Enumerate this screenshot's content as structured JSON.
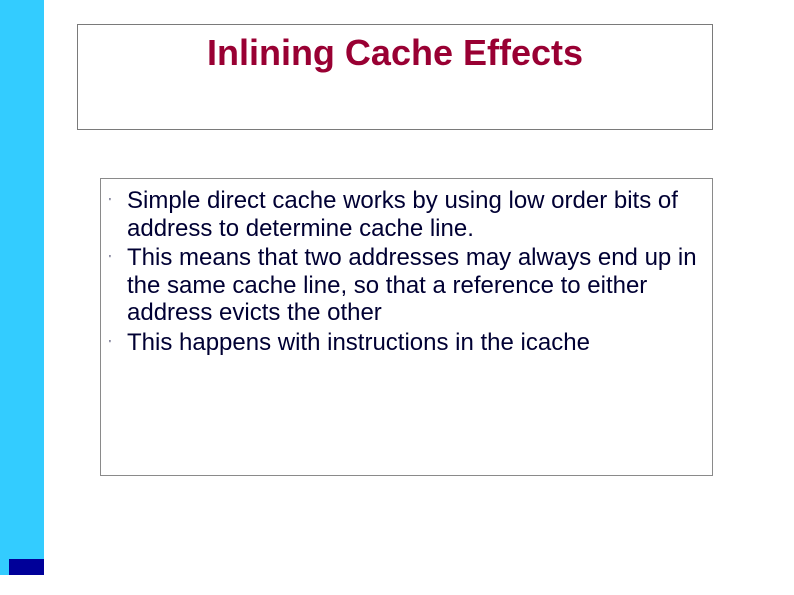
{
  "title": "Inlining Cache Effects",
  "bullets": [
    "Simple direct cache works by using low order bits of address to determine cache line.",
    "This means that two addresses may always end up in the same cache line, so that a reference to either address evicts the other",
    "This happens with instructions in the icache"
  ]
}
